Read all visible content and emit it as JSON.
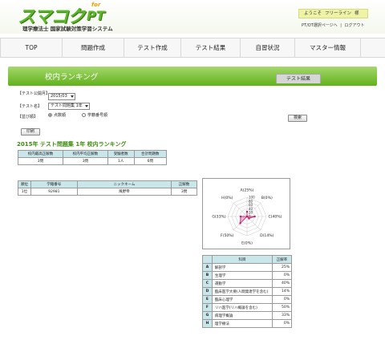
{
  "logo": {
    "main": "スマコク",
    "for": "for",
    "pt": "PT",
    "subtitle": "理学療法士 国家試験対策学習システム"
  },
  "welcome": {
    "prefix": "ようこそ",
    "user": "フリーライン",
    "suffix": "様"
  },
  "toplinks": {
    "switch": "PT/OT選択ページへ",
    "sep": "|",
    "logout": "ログアウト"
  },
  "nav": [
    {
      "label": "TOP"
    },
    {
      "label": "問題作成"
    },
    {
      "label": "テスト作成"
    },
    {
      "label": "テスト結果"
    },
    {
      "label": "自習状況"
    },
    {
      "label": "マスター情報"
    }
  ],
  "banner": {
    "title": "校内ランキング",
    "tab": "テスト結果"
  },
  "form": {
    "test_date_label": "【テスト公開月】",
    "test_date_value": "2015/03",
    "test_name_label": "【テスト名】",
    "test_name_value": "テスト問題集 1年",
    "sort_label": "【並び順】",
    "radio_score": "点数順",
    "radio_number": "学籍番号順",
    "search_button": "検索",
    "print_button": "印刷"
  },
  "section_title": "2015年 テスト問題集 1年 校内ランキング",
  "summary": {
    "headers": [
      "校内最高正解数",
      "校内平均正解数",
      "受験者数",
      "合計問題数"
    ],
    "values": [
      "3問",
      "3問",
      "1人",
      "6問"
    ]
  },
  "ranking": {
    "headers": [
      "順位",
      "学籍番号",
      "ニックネーム",
      "正解数"
    ],
    "rows": [
      [
        "1位",
        "92981",
        "風野帝",
        "3問"
      ]
    ]
  },
  "radar": {
    "axes": [
      "A(25%)",
      "B(0%)",
      "C(40%)",
      "D(14%)",
      "E(0%)",
      "F(50%)",
      "G(33%)",
      "H(0%)"
    ],
    "values": [
      25,
      0,
      40,
      14,
      0,
      50,
      33,
      0
    ],
    "scale_labels": [
      "100",
      "80",
      "60",
      "40",
      "20",
      "0"
    ],
    "fill_color": "#e79ac4",
    "stroke_color": "#c0186a"
  },
  "categories": {
    "headers": [
      "",
      "科目",
      "正解率"
    ],
    "rows": [
      [
        "A",
        "解剖学",
        "25%"
      ],
      [
        "B",
        "生理学",
        "0%"
      ],
      [
        "C",
        "運動学",
        "40%"
      ],
      [
        "D",
        "臨床医学大要(人間発達学を含む)",
        "14%"
      ],
      [
        "E",
        "臨床心理学",
        "0%"
      ],
      [
        "F",
        "リハ医学(リハ概論を含む)",
        "50%"
      ],
      [
        "G",
        "病理学概論",
        "33%"
      ],
      [
        "H",
        "理学療法",
        "0%"
      ]
    ]
  }
}
